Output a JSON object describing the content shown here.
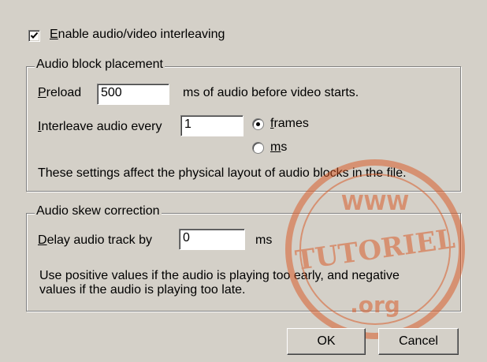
{
  "interleave": {
    "checked": true,
    "label_accel": "E",
    "label_rest": "nable audio/video interleaving"
  },
  "block_group": {
    "title": "Audio block placement",
    "preload_accel": "P",
    "preload_rest": "reload",
    "preload_value": "500",
    "preload_suffix": "ms of audio before video starts.",
    "interleave_accel": "I",
    "interleave_rest": "nterleave audio every",
    "interleave_value": "1",
    "frames_accel": "f",
    "frames_rest": "rames",
    "frames_selected": true,
    "ms_accel": "m",
    "ms_rest": "s",
    "note": "These settings affect the physical layout of audio blocks in the file."
  },
  "skew_group": {
    "title": "Audio skew correction",
    "delay_accel": "D",
    "delay_rest": "elay audio track by",
    "delay_value": "0",
    "delay_unit": "ms",
    "note_line1": "Use positive values if the audio is playing too early, and negative",
    "note_line2": "values if the audio is playing too late."
  },
  "buttons": {
    "ok": "OK",
    "cancel": "Cancel"
  },
  "watermark": {
    "top": "WWW",
    "middle": "TUTORIEL",
    "bottom": ".org",
    "color": "#d9541e"
  }
}
